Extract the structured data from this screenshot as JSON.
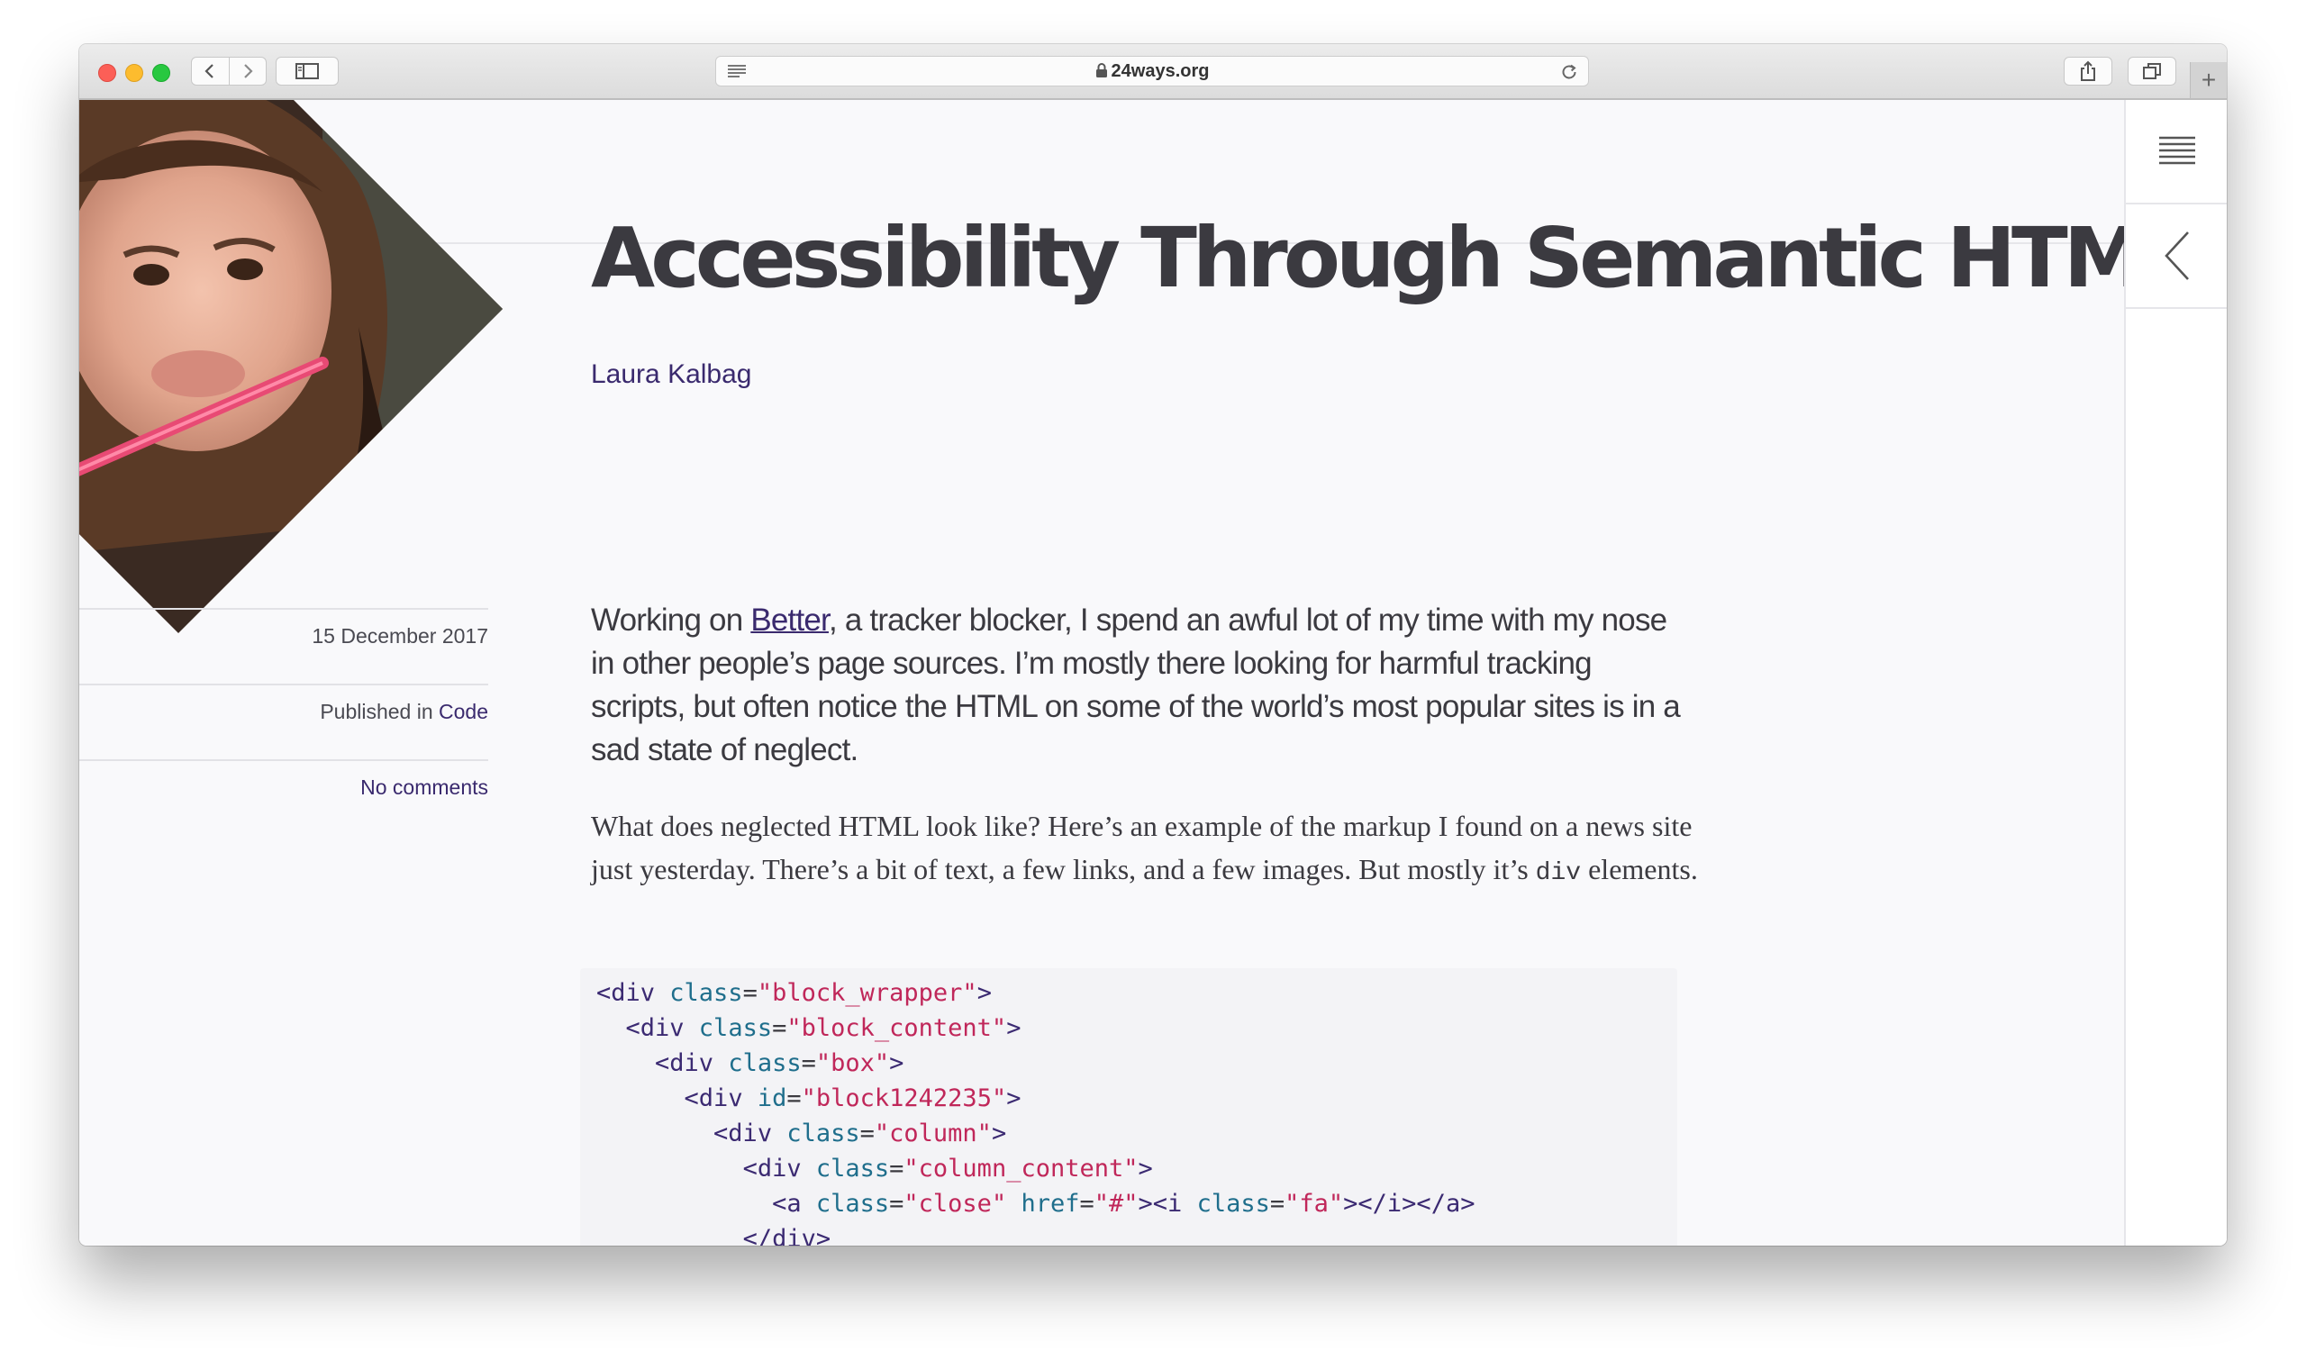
{
  "browser": {
    "url_domain": "24ways.org",
    "new_tab_label": "+"
  },
  "article": {
    "title": "Accessibility Through Semantic HTML",
    "author": "Laura Kalbag",
    "date": "15 December 2017",
    "published_prefix": "Published in ",
    "category": "Code",
    "comments": "No comments",
    "lead_before": "Working on ",
    "lead_link": "Better",
    "lead_after": ", a tracker blocker, I spend an awful lot of my time with my nose in other people’s page sources. I’m mostly there looking for harmful tracking scripts, but often notice the HTML on some of the world’s most popular sites is in a sad state of neglect.",
    "body_before": "What does neglected HTML look like? Here’s an example of the markup I found on a news site just yesterday. There’s a bit of text, a few links, and a few images. But mostly it’s ",
    "body_code": "div",
    "body_after": " elements."
  },
  "code_lines": [
    {
      "indent": "",
      "tokens": [
        [
          "tag",
          "<div"
        ],
        [
          "attr",
          " class"
        ],
        [
          "punc",
          "="
        ],
        [
          "val",
          "\"block_wrapper\""
        ],
        [
          "tag",
          ">"
        ]
      ]
    },
    {
      "indent": "  ",
      "tokens": [
        [
          "tag",
          "<div"
        ],
        [
          "attr",
          " class"
        ],
        [
          "punc",
          "="
        ],
        [
          "val",
          "\"block_content\""
        ],
        [
          "tag",
          ">"
        ]
      ]
    },
    {
      "indent": "    ",
      "tokens": [
        [
          "tag",
          "<div"
        ],
        [
          "attr",
          " class"
        ],
        [
          "punc",
          "="
        ],
        [
          "val",
          "\"box\""
        ],
        [
          "tag",
          ">"
        ]
      ]
    },
    {
      "indent": "      ",
      "tokens": [
        [
          "tag",
          "<div"
        ],
        [
          "attr",
          " id"
        ],
        [
          "punc",
          "="
        ],
        [
          "val",
          "\"block1242235\""
        ],
        [
          "tag",
          ">"
        ]
      ]
    },
    {
      "indent": "        ",
      "tokens": [
        [
          "tag",
          "<div"
        ],
        [
          "attr",
          " class"
        ],
        [
          "punc",
          "="
        ],
        [
          "val",
          "\"column\""
        ],
        [
          "tag",
          ">"
        ]
      ]
    },
    {
      "indent": "          ",
      "tokens": [
        [
          "tag",
          "<div"
        ],
        [
          "attr",
          " class"
        ],
        [
          "punc",
          "="
        ],
        [
          "val",
          "\"column_content\""
        ],
        [
          "tag",
          ">"
        ]
      ]
    },
    {
      "indent": "            ",
      "tokens": [
        [
          "tag",
          "<a"
        ],
        [
          "attr",
          " class"
        ],
        [
          "punc",
          "="
        ],
        [
          "val",
          "\"close\""
        ],
        [
          "attr",
          " href"
        ],
        [
          "punc",
          "="
        ],
        [
          "val",
          "\"#\""
        ],
        [
          "tag",
          "><i"
        ],
        [
          "attr",
          " class"
        ],
        [
          "punc",
          "="
        ],
        [
          "val",
          "\"fa\""
        ],
        [
          "tag",
          "></i></a>"
        ]
      ]
    },
    {
      "indent": "          ",
      "tokens": [
        [
          "tag",
          "</div>"
        ]
      ]
    }
  ],
  "icons": {
    "reader": "reader-icon",
    "lock": "lock-icon",
    "reload": "reload-icon",
    "share": "share-icon",
    "tabs": "tabs-overview-icon",
    "menu": "menu-icon",
    "back": "chevron-left-icon"
  },
  "colors": {
    "link": "#3a2a6e",
    "title": "#3b3a40",
    "code_attr": "#1f6e8c",
    "code_value": "#c0275a",
    "page_bg": "#f9f9fb"
  }
}
